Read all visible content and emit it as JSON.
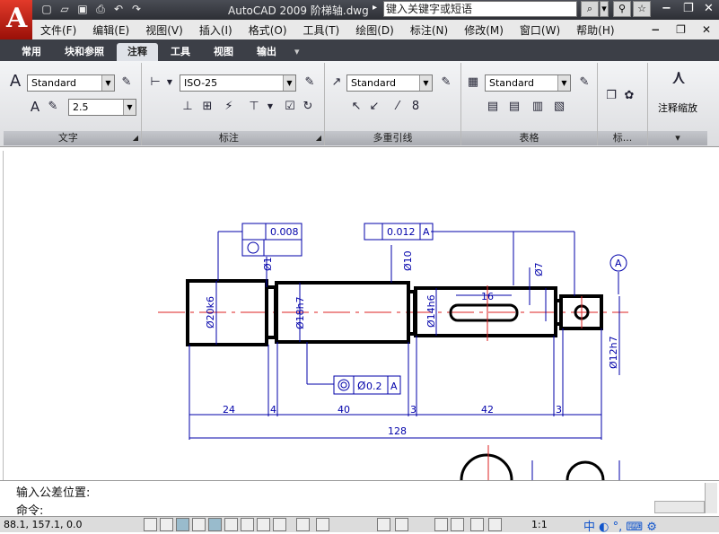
{
  "titlebar": {
    "app": "AutoCAD 2009",
    "file": "阶梯轴.dwg",
    "search_placeholder": "键入关键字或短语"
  },
  "menu": [
    "文件(F)",
    "编辑(E)",
    "视图(V)",
    "插入(I)",
    "格式(O)",
    "工具(T)",
    "绘图(D)",
    "标注(N)",
    "修改(M)",
    "窗口(W)",
    "帮助(H)"
  ],
  "tabs": [
    "常用",
    "块和参照",
    "注释",
    "工具",
    "视图",
    "输出"
  ],
  "ribbon": {
    "text": {
      "title": "文字",
      "style": "Standard",
      "height": "2.5"
    },
    "dim": {
      "title": "标注",
      "style": "ISO-25"
    },
    "mleader": {
      "title": "多重引线",
      "style": "Standard"
    },
    "table": {
      "title": "表格",
      "style": "Standard"
    },
    "mark": {
      "title": "标..."
    },
    "scale": {
      "title": "注释缩放"
    }
  },
  "drawing": {
    "dims": [
      "24",
      "4",
      "40",
      "3",
      "42",
      "3",
      "128"
    ],
    "labels": [
      "Ø20k6",
      "Ø18h7",
      "Ø14h6",
      "Ø12h7",
      "Ø10",
      "Ø7",
      "Ø1",
      "16"
    ],
    "tol1": "0.008",
    "tol2": "0.012",
    "tol3": "0.2",
    "datum": "A"
  },
  "command": {
    "line1": "输入公差位置:",
    "line2": "命令:"
  },
  "status": {
    "coords": "88.1, 157.1, 0.0",
    "scale": "1:1"
  }
}
